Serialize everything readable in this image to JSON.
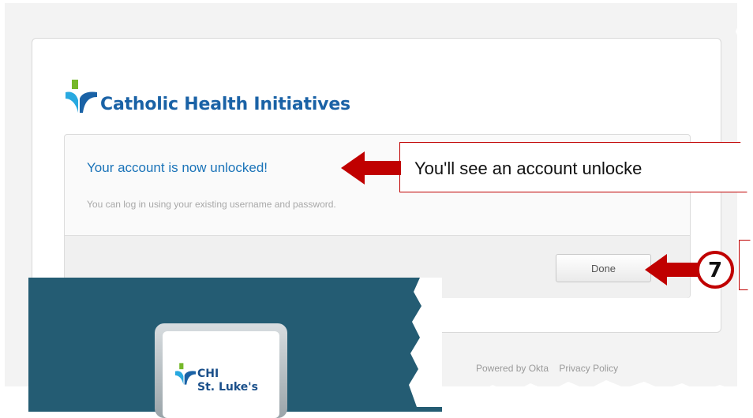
{
  "brand": {
    "org_name": "Catholic Health Initiatives",
    "primary_color": "#1a62a6",
    "accent_green": "#76b82a",
    "accent_cyan": "#28a9e0"
  },
  "message": {
    "title": "Your account is now unlocked!",
    "subtitle": "You can log in using your existing username and password."
  },
  "actions": {
    "done_label": "Done"
  },
  "footer": {
    "powered_by": "Powered by Okta",
    "privacy": "Privacy Policy"
  },
  "annotation": {
    "callout_text": "You'll see an account unlocke",
    "step_number": "7",
    "arrow_color": "#c00000"
  },
  "inset": {
    "line1": "CHI",
    "line2": "St. Luke's",
    "bg_color": "#245c73"
  }
}
